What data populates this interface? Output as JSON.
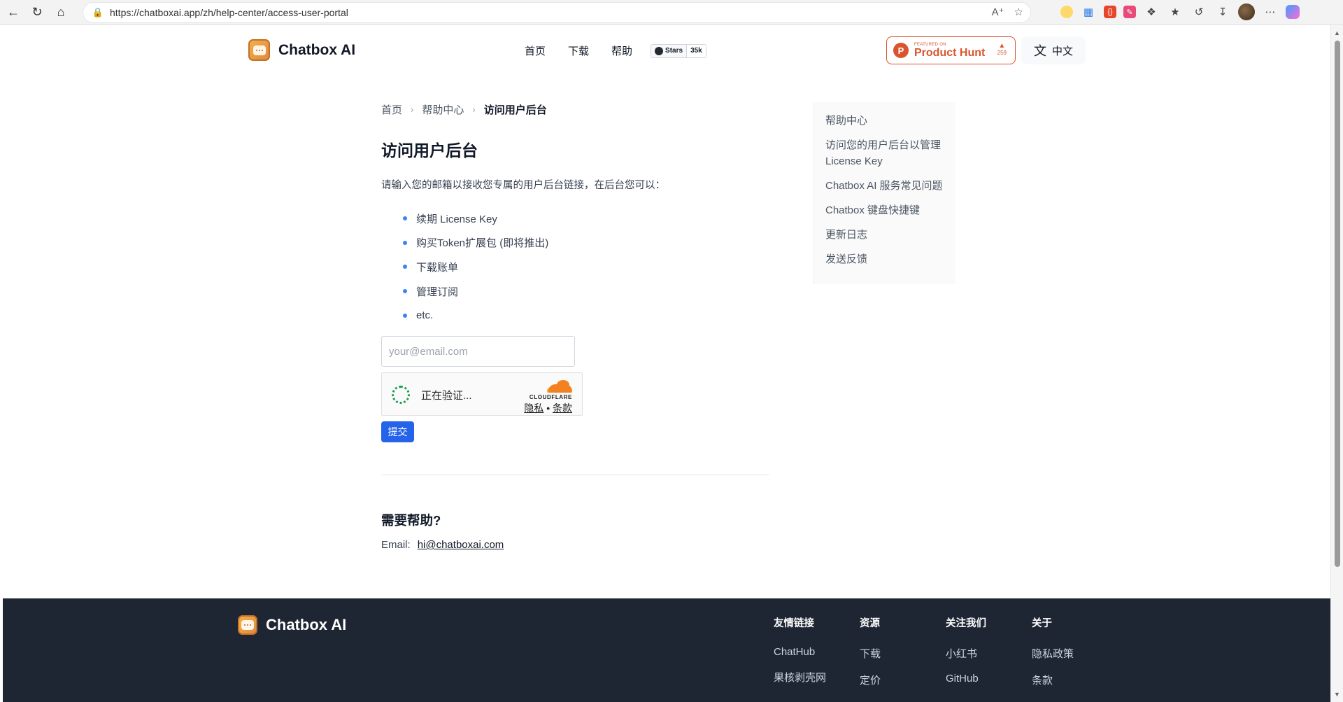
{
  "browser": {
    "url": "https://chatboxai.app/zh/help-center/access-user-portal"
  },
  "site": {
    "logo_text": "Chatbox AI",
    "nav": [
      "首页",
      "下载",
      "帮助"
    ],
    "github": {
      "label": "Stars",
      "count": "35k"
    },
    "product_hunt": {
      "small": "FEATURED ON",
      "big": "Product Hunt",
      "count": "259"
    },
    "language": "中文"
  },
  "breadcrumb": {
    "home": "首页",
    "help_center": "帮助中心",
    "current": "访问用户后台"
  },
  "main": {
    "title": "访问用户后台",
    "intro": "请输入您的邮箱以接收您专属的用户后台链接，在后台您可以：",
    "features": [
      "续期 License Key",
      "购买Token扩展包 (即将推出)",
      "下载账单",
      "管理订阅",
      "etc."
    ],
    "email_placeholder": "your@email.com",
    "turnstile": {
      "status": "正在验证...",
      "brand": "CLOUDFLARE",
      "privacy": "隐私",
      "dot": " • ",
      "terms": "条款"
    },
    "submit_label": "提交",
    "help_title": "需要帮助?",
    "email_label": "Email:",
    "email_address": "hi@chatboxai.com"
  },
  "toc": [
    "帮助中心",
    "访问您的用户后台以管理 License Key",
    "Chatbox AI 服务常见问题",
    "Chatbox 键盘快捷键",
    "更新日志",
    "发送反馈"
  ],
  "footer": {
    "logo_text": "Chatbox AI",
    "columns": [
      {
        "title": "友情链接",
        "links": [
          "ChatHub",
          "果核剥壳网"
        ]
      },
      {
        "title": "资源",
        "links": [
          "下载",
          "定价"
        ]
      },
      {
        "title": "关注我们",
        "links": [
          "小红书",
          "GitHub"
        ]
      },
      {
        "title": "关于",
        "links": [
          "隐私政策",
          "条款"
        ]
      }
    ]
  }
}
